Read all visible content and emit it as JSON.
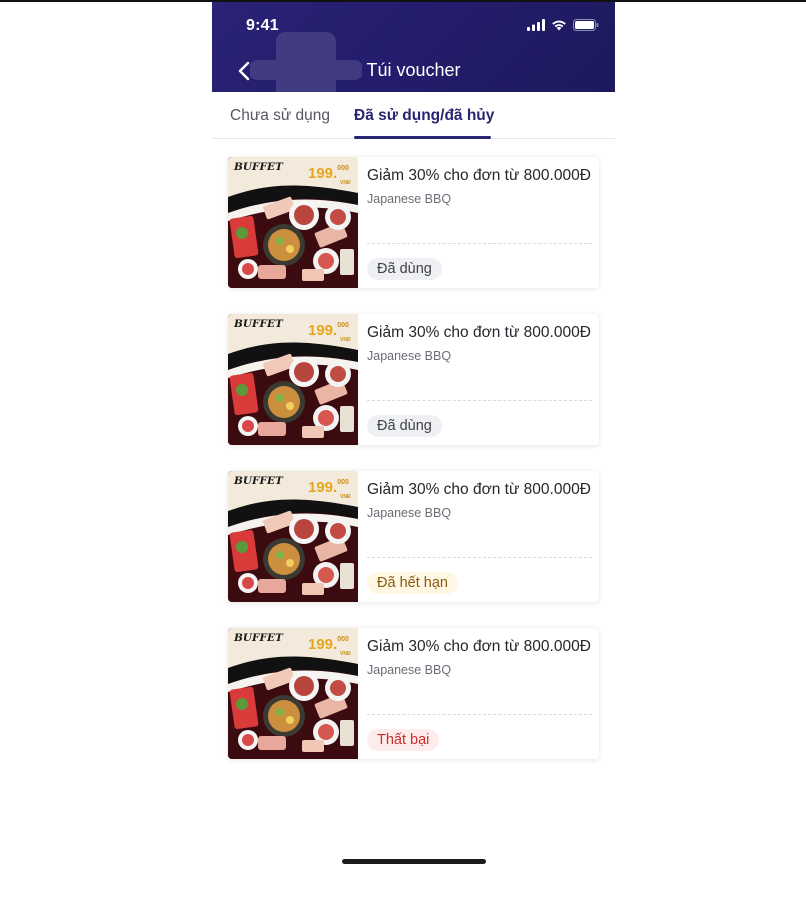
{
  "status_bar": {
    "time": "9:41"
  },
  "header": {
    "title": "Túi voucher"
  },
  "tabs": [
    {
      "label": "Chưa sử dụng",
      "active": false
    },
    {
      "label": "Đã sử dụng/đã hủy",
      "active": true
    }
  ],
  "thumbnail": {
    "buffet_text": "BUFFET",
    "price_text": "199.",
    "price_sup": "000",
    "price_unit": "VNĐ"
  },
  "vouchers": [
    {
      "title": "Giảm 30% cho đơn từ 800.000Đ",
      "merchant": "Japanese BBQ",
      "status": "Đã dùng",
      "status_color": "#3f4148",
      "status_bg": "#eef0f3"
    },
    {
      "title": "Giảm 30% cho đơn từ 800.000Đ",
      "merchant": "Japanese BBQ",
      "status": "Đã dùng",
      "status_color": "#3f4148",
      "status_bg": "#eef0f3"
    },
    {
      "title": "Giảm 30% cho đơn từ 800.000Đ",
      "merchant": "Japanese BBQ",
      "status": "Đã hết hạn",
      "status_color": "#8a5a10",
      "status_bg": "#fff7e3"
    },
    {
      "title": "Giảm 30% cho đơn từ 800.000Đ",
      "merchant": "Japanese BBQ",
      "status": "Thất bại",
      "status_color": "#cf2a2a",
      "status_bg": "#fdecec"
    }
  ],
  "colors": {
    "header": "#241d6d",
    "accent": "#2a2570"
  }
}
